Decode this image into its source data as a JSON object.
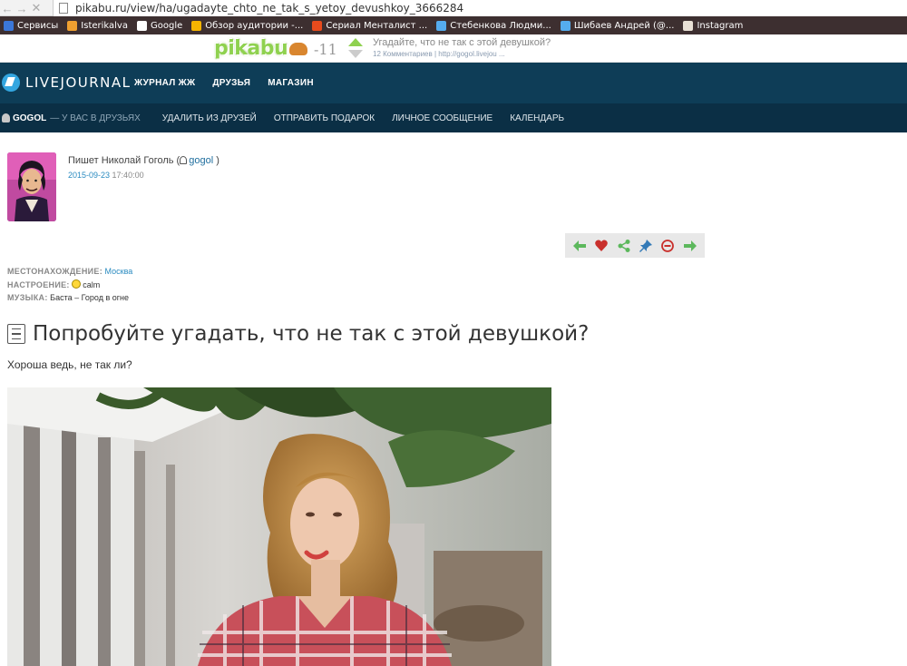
{
  "browser": {
    "url": "pikabu.ru/view/ha/ugadayte_chto_ne_tak_s_yetoy_devushkoy_3666284",
    "bookmarks": [
      {
        "label": "Сервисы",
        "color": "#3b77d8"
      },
      {
        "label": "Isterikalva",
        "color": "#f0a030"
      },
      {
        "label": "Google",
        "color": "#ffffff"
      },
      {
        "label": "Обзор аудитории -...",
        "color": "#f6b400"
      },
      {
        "label": "Сериал Менталист ...",
        "color": "#e84b1d"
      },
      {
        "label": "Стебенкова Людми...",
        "color": "#55acee"
      },
      {
        "label": "Шибаев Андрей (@...",
        "color": "#55acee"
      },
      {
        "label": "Instagram",
        "color": "#e8e0d5"
      }
    ]
  },
  "pikabu": {
    "logo": "pikabu",
    "score": "-11",
    "title": "Угадайте, что не так с этой девушкой?",
    "subtitle": "12 Комментариев | http://gogol.livejou ..."
  },
  "lj": {
    "logo": "LIVEJOURNAL",
    "menu": [
      "ЖУРНАЛ ЖЖ",
      "ДРУЗЬЯ",
      "МАГАЗИН"
    ],
    "user": "GOGOL",
    "friend_note": "— У ВАС В ДРУЗЬЯХ",
    "actions": [
      "УДАЛИТЬ ИЗ ДРУЗЕЙ",
      "ОТПРАВИТЬ ПОДАРОК",
      "ЛИЧНОЕ СООБЩЕНИЕ",
      "КАЛЕНДАРЬ"
    ]
  },
  "entry": {
    "author_prefix": "Пишет Николай Гоголь (",
    "author_user": "gogol",
    "author_suffix": " )",
    "date": "2015-09-23",
    "time": " 17:40:00",
    "meta": {
      "location_label": "МЕСТОНАХОЖДЕНИЕ:",
      "location": "Москва",
      "mood_label": "НАСТРОЕНИЕ:",
      "mood": "calm",
      "music_label": "МУЗЫКА:",
      "music": "Баста – Город в огне"
    },
    "title": "Попробуйте угадать, что не так с этой девушкой?",
    "lead": "Хороша ведь, не так ли?"
  },
  "colors": {
    "lj_header": "#0e3d57",
    "lj_subheader": "#0b2f45",
    "link": "#2a8bc0",
    "pikabu_green": "#8fd14f"
  }
}
